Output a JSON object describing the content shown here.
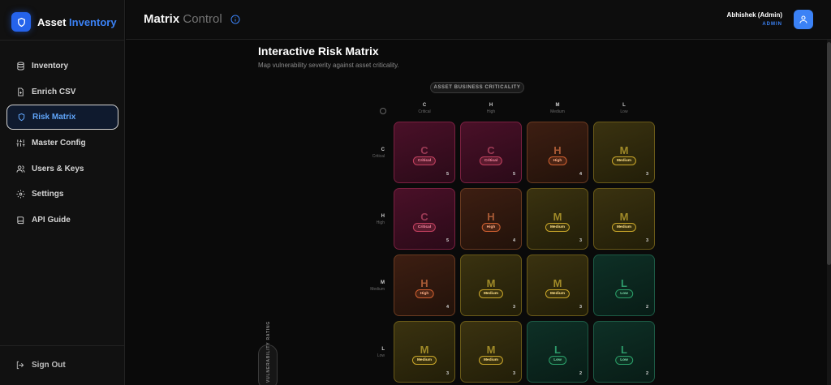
{
  "brand": {
    "name": "Asset",
    "accent": "Inventory"
  },
  "sidebar": {
    "items": [
      {
        "label": "Inventory",
        "icon": "database-icon"
      },
      {
        "label": "Enrich CSV",
        "icon": "file-plus-icon"
      },
      {
        "label": "Risk Matrix",
        "icon": "shield-icon",
        "active": true
      },
      {
        "label": "Master Config",
        "icon": "sliders-icon"
      },
      {
        "label": "Users & Keys",
        "icon": "users-icon"
      },
      {
        "label": "Settings",
        "icon": "gear-icon"
      },
      {
        "label": "API Guide",
        "icon": "book-icon"
      }
    ],
    "signout": "Sign Out"
  },
  "header": {
    "title": "Matrix",
    "subtitle": "Control",
    "user_name": "Abhishek (Admin)",
    "user_role": "ADMIN"
  },
  "main": {
    "title": "Interactive Risk Matrix",
    "subtitle": "Map vulnerability severity against asset criticality.",
    "criticality_label": "ASSET BUSINESS CRITICALITY",
    "vuln_label": "VULNERABILITY RATING",
    "columns": [
      {
        "letter": "C",
        "label": "Critical"
      },
      {
        "letter": "H",
        "label": "High"
      },
      {
        "letter": "M",
        "label": "Medium"
      },
      {
        "letter": "L",
        "label": "Low"
      }
    ],
    "rows": [
      {
        "letter": "C",
        "label": "Critical"
      },
      {
        "letter": "H",
        "label": "High"
      },
      {
        "letter": "M",
        "label": "Medium"
      },
      {
        "letter": "L",
        "label": "Low"
      }
    ],
    "cells": [
      [
        {
          "letter": "C",
          "label": "Critical",
          "level": "critical",
          "score": "5"
        },
        {
          "letter": "C",
          "label": "Critical",
          "level": "critical",
          "score": "5"
        },
        {
          "letter": "H",
          "label": "High",
          "level": "high",
          "score": "4"
        },
        {
          "letter": "M",
          "label": "Medium",
          "level": "medium",
          "score": "3"
        }
      ],
      [
        {
          "letter": "C",
          "label": "Critical",
          "level": "critical",
          "score": "5"
        },
        {
          "letter": "H",
          "label": "High",
          "level": "high",
          "score": "4"
        },
        {
          "letter": "M",
          "label": "Medium",
          "level": "medium",
          "score": "3"
        },
        {
          "letter": "M",
          "label": "Medium",
          "level": "medium",
          "score": "3"
        }
      ],
      [
        {
          "letter": "H",
          "label": "High",
          "level": "high",
          "score": "4"
        },
        {
          "letter": "M",
          "label": "Medium",
          "level": "medium",
          "score": "3"
        },
        {
          "letter": "M",
          "label": "Medium",
          "level": "medium",
          "score": "3"
        },
        {
          "letter": "L",
          "label": "Low",
          "level": "low",
          "score": "2"
        }
      ],
      [
        {
          "letter": "M",
          "label": "Medium",
          "level": "medium",
          "score": "3"
        },
        {
          "letter": "M",
          "label": "Medium",
          "level": "medium",
          "score": "3"
        },
        {
          "letter": "L",
          "label": "Low",
          "level": "low",
          "score": "2"
        },
        {
          "letter": "L",
          "label": "Low",
          "level": "low",
          "score": "2"
        }
      ]
    ]
  }
}
